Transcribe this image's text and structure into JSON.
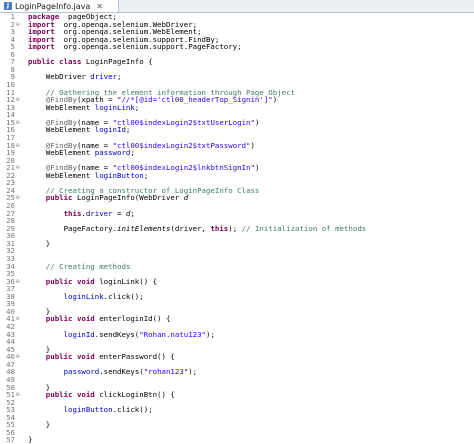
{
  "tab": {
    "title": "LoginPageInfo.java",
    "close_glyph": "✕"
  },
  "lines": [
    {
      "n": "1",
      "m": "",
      "seg": [
        [
          "kw",
          "package"
        ],
        [
          "",
          "  pageObject;"
        ]
      ]
    },
    {
      "n": "2",
      "m": "⊖",
      "seg": [
        [
          "kw",
          "import"
        ],
        [
          "",
          "  org.openqa.selenium.WebDriver;"
        ]
      ]
    },
    {
      "n": "3",
      "m": "",
      "seg": [
        [
          "kw",
          "import"
        ],
        [
          "",
          "  org.openqa.selenium.WebElement;"
        ]
      ]
    },
    {
      "n": "4",
      "m": "",
      "seg": [
        [
          "kw",
          "import"
        ],
        [
          "",
          "  org.openqa.selenium.support.FindBy;"
        ]
      ]
    },
    {
      "n": "5",
      "m": "",
      "seg": [
        [
          "kw",
          "import"
        ],
        [
          "",
          "  org.openqa.selenium.support.PageFactory;"
        ]
      ]
    },
    {
      "n": "6",
      "m": "",
      "seg": []
    },
    {
      "n": "7",
      "m": "",
      "seg": [
        [
          "kw",
          "public class"
        ],
        [
          "",
          " LoginPageInfo {"
        ]
      ]
    },
    {
      "n": "8",
      "m": "",
      "seg": []
    },
    {
      "n": "9",
      "m": "",
      "seg": [
        [
          "",
          "    WebDriver "
        ],
        [
          "fld",
          "driver"
        ],
        [
          "",
          ";"
        ]
      ]
    },
    {
      "n": "10",
      "m": "",
      "seg": []
    },
    {
      "n": "11",
      "m": "",
      "seg": [
        [
          "cm",
          "    // Gathering the element information through Page Object"
        ]
      ]
    },
    {
      "n": "12",
      "m": "⊖",
      "seg": [
        [
          "ann",
          "    @FindBy"
        ],
        [
          "",
          "(xpath = "
        ],
        [
          "str",
          "\"//*[@id='ctl00_headerTop_Signin']\""
        ],
        [
          "",
          ")"
        ]
      ]
    },
    {
      "n": "13",
      "m": "",
      "seg": [
        [
          "",
          "    WebElement "
        ],
        [
          "fld",
          "loginLink"
        ],
        [
          "",
          ";"
        ]
      ]
    },
    {
      "n": "14",
      "m": "",
      "seg": []
    },
    {
      "n": "15",
      "m": "⊖",
      "seg": [
        [
          "ann",
          "    @FindBy"
        ],
        [
          "",
          "(name = "
        ],
        [
          "str",
          "\"ctl00$indexLogin2$txtUserLogin\""
        ],
        [
          "",
          ")"
        ]
      ]
    },
    {
      "n": "16",
      "m": "",
      "seg": [
        [
          "",
          "    WebElement "
        ],
        [
          "fld",
          "loginId"
        ],
        [
          "",
          ";"
        ]
      ]
    },
    {
      "n": "17",
      "m": "",
      "seg": []
    },
    {
      "n": "18",
      "m": "⊖",
      "seg": [
        [
          "ann",
          "    @FindBy"
        ],
        [
          "",
          "(name = "
        ],
        [
          "str",
          "\"ctl00$indexLogin2$txtPassword\""
        ],
        [
          "",
          ")"
        ]
      ]
    },
    {
      "n": "19",
      "m": "",
      "seg": [
        [
          "",
          "    WebElement "
        ],
        [
          "fld",
          "password"
        ],
        [
          "",
          ";"
        ]
      ]
    },
    {
      "n": "20",
      "m": "",
      "seg": []
    },
    {
      "n": "21",
      "m": "⊖",
      "seg": [
        [
          "ann",
          "    @FindBy"
        ],
        [
          "",
          "(name = "
        ],
        [
          "str",
          "\"ctl00$indexLogin2$lnkbtnSignIn\""
        ],
        [
          "",
          ")"
        ]
      ]
    },
    {
      "n": "22",
      "m": "",
      "seg": [
        [
          "",
          "    WebElement "
        ],
        [
          "fld",
          "loginButton"
        ],
        [
          "",
          ";"
        ]
      ]
    },
    {
      "n": "23",
      "m": "",
      "seg": []
    },
    {
      "n": "24",
      "m": "",
      "seg": [
        [
          "cm",
          "    // Creating a constructor of LoginPageInfo Class"
        ]
      ]
    },
    {
      "n": "25",
      "m": "⊖",
      "seg": [
        [
          "kw",
          "    public"
        ],
        [
          "",
          " LoginPageInfo(WebDriver "
        ],
        [
          "it",
          "d"
        ],
        [
          ") {"
        ]
      ]
    },
    {
      "n": "26",
      "m": "",
      "seg": []
    },
    {
      "n": "27",
      "m": "",
      "seg": [
        [
          "kw",
          "        this"
        ],
        [
          "",
          "."
        ],
        [
          "fld",
          "driver"
        ],
        [
          "",
          " = "
        ],
        [
          "it",
          "d"
        ],
        [
          "",
          ";"
        ]
      ]
    },
    {
      "n": "28",
      "m": "",
      "seg": []
    },
    {
      "n": "29",
      "m": "",
      "seg": [
        [
          "",
          "        PageFactory."
        ],
        [
          "it",
          "initElements"
        ],
        [
          "",
          "(driver, "
        ],
        [
          "kw",
          "this"
        ],
        [
          "",
          "); "
        ],
        [
          "cm",
          "// Initialization of methods"
        ]
      ]
    },
    {
      "n": "30",
      "m": "",
      "seg": []
    },
    {
      "n": "31",
      "m": "",
      "seg": [
        [
          "",
          "    }"
        ]
      ]
    },
    {
      "n": "32",
      "m": "",
      "seg": []
    },
    {
      "n": "33",
      "m": "",
      "seg": []
    },
    {
      "n": "34",
      "m": "",
      "seg": [
        [
          "cm",
          "    // Creating methods"
        ]
      ]
    },
    {
      "n": "35",
      "m": "",
      "seg": []
    },
    {
      "n": "36",
      "m": "⊖",
      "seg": [
        [
          "kw",
          "    public void"
        ],
        [
          "",
          " loginLink() {"
        ]
      ]
    },
    {
      "n": "37",
      "m": "",
      "seg": []
    },
    {
      "n": "38",
      "m": "",
      "seg": [
        [
          "",
          "        "
        ],
        [
          "fld",
          "loginLink"
        ],
        [
          "",
          ".click();"
        ]
      ]
    },
    {
      "n": "39",
      "m": "",
      "seg": []
    },
    {
      "n": "40",
      "m": "",
      "seg": [
        [
          "",
          "    }"
        ]
      ]
    },
    {
      "n": "41",
      "m": "⊖",
      "seg": [
        [
          "kw",
          "    public void"
        ],
        [
          "",
          " enterloginId() {"
        ]
      ]
    },
    {
      "n": "42",
      "m": "",
      "seg": []
    },
    {
      "n": "43",
      "m": "",
      "seg": [
        [
          "",
          "        "
        ],
        [
          "fld",
          "loginId"
        ],
        [
          "",
          ".sendKeys("
        ],
        [
          "str",
          "\"Rohan.natu123\""
        ],
        [
          "",
          ");"
        ]
      ]
    },
    {
      "n": "44",
      "m": "",
      "seg": []
    },
    {
      "n": "45",
      "m": "",
      "seg": [
        [
          "",
          "    }"
        ]
      ]
    },
    {
      "n": "46",
      "m": "⊖",
      "seg": [
        [
          "kw",
          "    public void"
        ],
        [
          "",
          " enterPassword() {"
        ]
      ]
    },
    {
      "n": "47",
      "m": "",
      "seg": []
    },
    {
      "n": "48",
      "m": "",
      "seg": [
        [
          "",
          "        "
        ],
        [
          "fld",
          "password"
        ],
        [
          "",
          ".sendKeys("
        ],
        [
          "str",
          "\"rohan123\""
        ],
        [
          "",
          ");"
        ]
      ]
    },
    {
      "n": "49",
      "m": "",
      "seg": []
    },
    {
      "n": "50",
      "m": "",
      "seg": [
        [
          "",
          "    }"
        ]
      ]
    },
    {
      "n": "51",
      "m": "⊖",
      "seg": [
        [
          "kw",
          "    public void"
        ],
        [
          "",
          " clickLoginBtn() {"
        ]
      ]
    },
    {
      "n": "52",
      "m": "",
      "seg": []
    },
    {
      "n": "53",
      "m": "",
      "seg": [
        [
          "",
          "        "
        ],
        [
          "fld",
          "loginButton"
        ],
        [
          "",
          ".click();"
        ]
      ]
    },
    {
      "n": "54",
      "m": "",
      "seg": []
    },
    {
      "n": "55",
      "m": "",
      "seg": [
        [
          "",
          "    }"
        ]
      ]
    },
    {
      "n": "56",
      "m": "",
      "seg": []
    },
    {
      "n": "57",
      "m": "",
      "seg": [
        [
          "",
          "}"
        ]
      ]
    }
  ]
}
